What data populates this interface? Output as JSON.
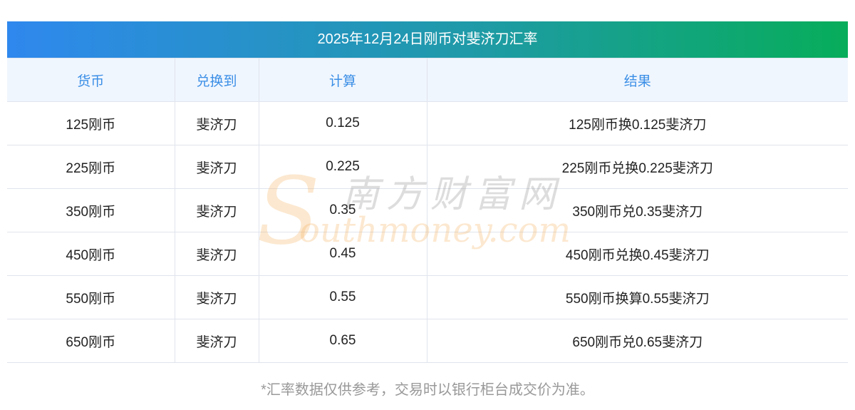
{
  "title": "2025年12月24日刚币对斐济刀汇率",
  "headers": [
    "货币",
    "兑换到",
    "计算",
    "结果"
  ],
  "rows": [
    [
      "125刚币",
      "斐济刀",
      "0.125",
      "125刚币换0.125斐济刀"
    ],
    [
      "225刚币",
      "斐济刀",
      "0.225",
      "225刚币兑换0.225斐济刀"
    ],
    [
      "350刚币",
      "斐济刀",
      "0.35",
      "350刚币兑0.35斐济刀"
    ],
    [
      "450刚币",
      "斐济刀",
      "0.45",
      "450刚币兑换0.45斐济刀"
    ],
    [
      "550刚币",
      "斐济刀",
      "0.55",
      "550刚币换算0.55斐济刀"
    ],
    [
      "650刚币",
      "斐济刀",
      "0.65",
      "650刚币兑0.65斐济刀"
    ]
  ],
  "watermark": {
    "cn": "南方财富网",
    "en": "outhmoney.com",
    "s": "S"
  },
  "note": "*汇率数据仅供参考，交易时以银行柜台成交价为准。"
}
